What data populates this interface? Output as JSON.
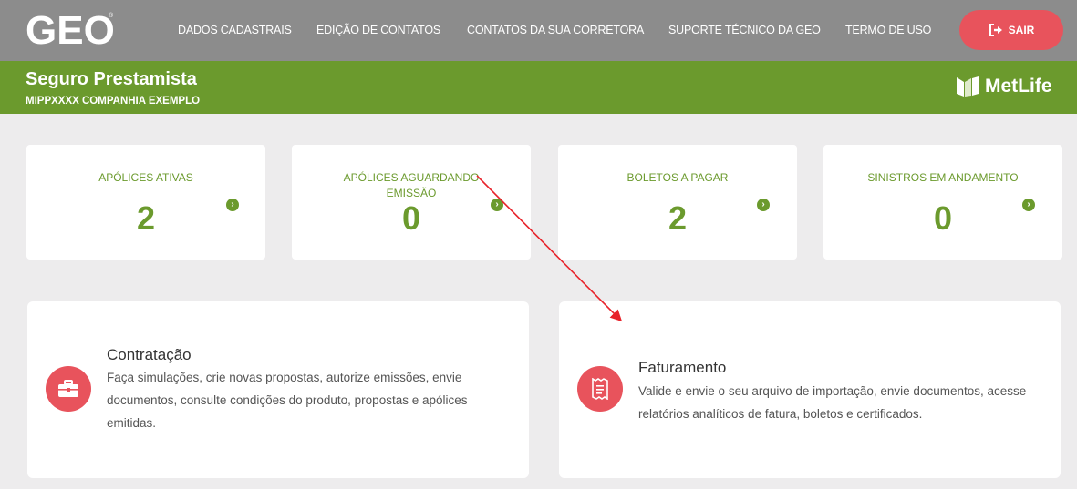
{
  "header": {
    "logo_text": "GEO",
    "nav": [
      {
        "label": "DADOS CADASTRAIS"
      },
      {
        "label": "EDIÇÃO DE CONTATOS"
      },
      {
        "label": "CONTATOS DA SUA CORRETORA"
      },
      {
        "label": "SUPORTE TÉCNICO DA GEO"
      },
      {
        "label": "TERMO DE USO"
      }
    ],
    "logout_label": "SAIR"
  },
  "banner": {
    "title": "Seguro Prestamista",
    "subtitle": "MIPPXXXX COMPANHIA EXEMPLO",
    "brand": "MetLife"
  },
  "stats": [
    {
      "label": "APÓLICES ATIVAS",
      "value": "2"
    },
    {
      "label": "APÓLICES AGUARDANDO EMISSÃO",
      "value": "0"
    },
    {
      "label": "BOLETOS A PAGAR",
      "value": "2"
    },
    {
      "label": "SINISTROS EM ANDAMENTO",
      "value": "0"
    }
  ],
  "cards": [
    {
      "title": "Contratação",
      "description": "Faça simulações, crie novas propostas, autorize emissões, envie documentos, consulte condições do produto, propostas e apólices emitidas.",
      "icon": "briefcase-icon"
    },
    {
      "title": "Faturamento",
      "description": "Valide e envie o seu arquivo de importação, envie documentos, acesse relatórios analíticos de fatura, boletos e certificados.",
      "icon": "receipt-icon"
    }
  ],
  "colors": {
    "topbar": "#8c8c8c",
    "brand_green": "#6b9a2d",
    "accent_red": "#e8535c",
    "background": "#edeced"
  }
}
